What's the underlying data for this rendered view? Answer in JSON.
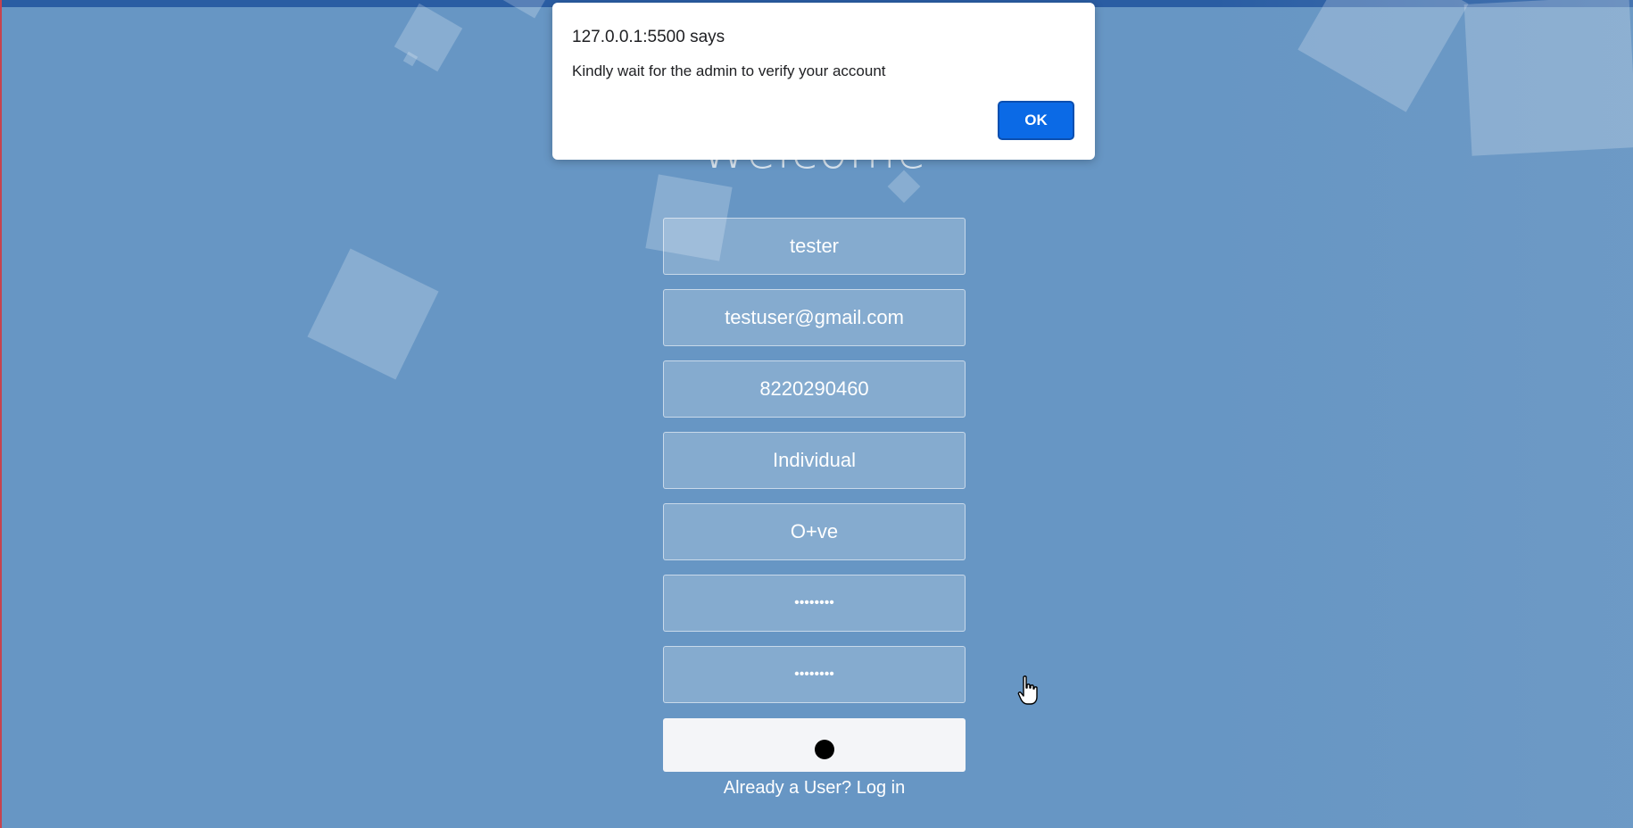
{
  "page": {
    "title": "Welcome"
  },
  "form": {
    "fields": [
      {
        "name": "username",
        "value": "tester"
      },
      {
        "name": "email",
        "value": "testuser@gmail.com"
      },
      {
        "name": "phone",
        "value": "8220290460"
      },
      {
        "name": "user_type",
        "value": "Individual"
      },
      {
        "name": "blood_group",
        "value": "O+ve"
      },
      {
        "name": "password",
        "value": "••••••••"
      },
      {
        "name": "confirm_password",
        "value": "••••••••"
      }
    ],
    "login_link": "Already a User? Log in"
  },
  "alert": {
    "title": "127.0.0.1:5500 says",
    "message": "Kindly wait for the admin to verify your account",
    "ok_label": "OK"
  },
  "colors": {
    "background": "#6796c4",
    "accent": "#0b6ae6"
  }
}
